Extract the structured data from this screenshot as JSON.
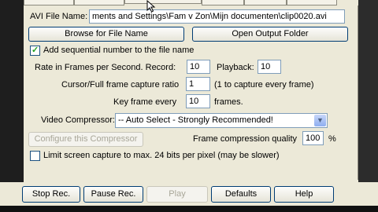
{
  "form": {
    "avi_label": "AVI File Name:",
    "avi_value": "ments and Settings\\Fam v Zon\\Mijn documenten\\clip0020.avi",
    "browse_label": "Browse for File Name",
    "open_folder_label": "Open Output Folder",
    "seq_label": "Add sequential number to the file name",
    "rate_label": "Rate in Frames per Second.  Record:",
    "record_value": "10",
    "playback_label": "Playback:",
    "playback_value": "10",
    "cursor_ratio_label": "Cursor/Full frame capture ratio",
    "cursor_ratio_value": "1",
    "cursor_ratio_hint": "(1 to capture every frame)",
    "keyframe_label": "Key frame every",
    "keyframe_value": "10",
    "keyframe_unit": "frames.",
    "compressor_label": "Video Compressor:",
    "compressor_value": "-- Auto Select - Strongly Recommended!",
    "configure_label": "Configure this Compressor",
    "quality_label": "Frame compression quality",
    "quality_value": "100",
    "quality_unit": "%",
    "limit_label": "Limit screen capture to max. 24 bits per pixel (may be slower)"
  },
  "buttons": {
    "stop": "Stop Rec.",
    "pause": "Pause Rec.",
    "play": "Play",
    "defaults": "Defaults",
    "help": "Help"
  },
  "state": {
    "seq_checked": true,
    "limit_checked": false
  },
  "colors": {
    "window_bg": "#ece9d8",
    "field_border": "#7f9db9",
    "button_border": "#003c74"
  }
}
